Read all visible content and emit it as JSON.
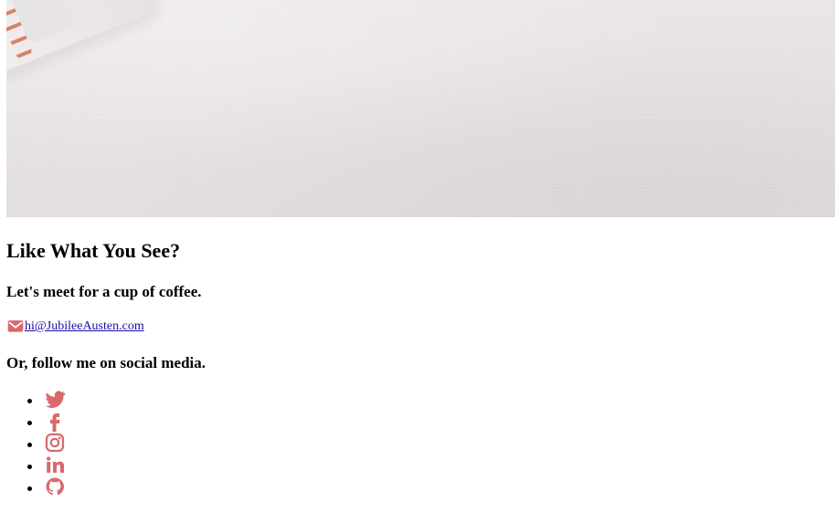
{
  "hero": {
    "image_semantic": "notebook-with-copper-spiral-on-textured-white-surface"
  },
  "colors": {
    "accent": "#d9696c",
    "link": "#1a0dab",
    "text": "#000000"
  },
  "content": {
    "title": "Like What You See?",
    "coffee_line": "Let's meet for a cup of coffee.",
    "email_icon": "envelope-icon",
    "email_text": "hi@JubileeAusten.com",
    "social_line": "Or, follow me on social media."
  },
  "social": {
    "items": [
      {
        "network": "twitter",
        "icon": "twitter-icon"
      },
      {
        "network": "facebook",
        "icon": "facebook-icon"
      },
      {
        "network": "instagram",
        "icon": "instagram-icon"
      },
      {
        "network": "linkedin",
        "icon": "linkedin-icon"
      },
      {
        "network": "github",
        "icon": "github-icon"
      }
    ]
  }
}
